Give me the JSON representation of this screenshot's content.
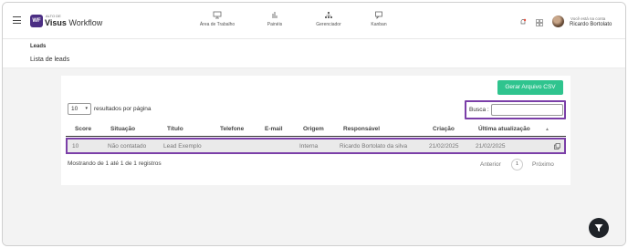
{
  "brand": {
    "small": "ALTO DE",
    "name_bold": "Visus",
    "name_rest": " Workflow",
    "badge": "WF",
    "accent": "#4b2e83"
  },
  "nav": [
    {
      "label": "Área de Trabalho",
      "icon": "monitor-icon"
    },
    {
      "label": "Painéis",
      "icon": "bar-chart-icon"
    },
    {
      "label": "Gerenciador",
      "icon": "hierarchy-icon"
    },
    {
      "label": "Kanban",
      "icon": "message-icon"
    }
  ],
  "account": {
    "prefix": "Você está na conta",
    "name": "Ricardo Bortolato"
  },
  "breadcrumb": "Leads",
  "subtitle": "Lista de leads",
  "toolbar": {
    "csv_label": "Gerar Arquivo CSV",
    "csv_color": "#2fc48e"
  },
  "length": {
    "value": "10",
    "label": "resultados por página"
  },
  "search": {
    "label": "Busca :",
    "value": ""
  },
  "table": {
    "headers": [
      "Score",
      "Situação",
      "Título",
      "Telefone",
      "E-mail",
      "Origem",
      "Responsável",
      "Criação",
      "Última atualização"
    ],
    "rows": [
      [
        "10",
        "Não contatado",
        "Lead Exemplo",
        "",
        "",
        "Interna",
        "Ricardo Bortolato da silva",
        "21/02/2025",
        "21/02/2025"
      ]
    ]
  },
  "info": "Mostrando de 1 até 1 de 1 registros",
  "pager": {
    "prev": "Anterior",
    "current": "1",
    "next": "Próximo"
  },
  "highlight_color": "#7b3fa8"
}
